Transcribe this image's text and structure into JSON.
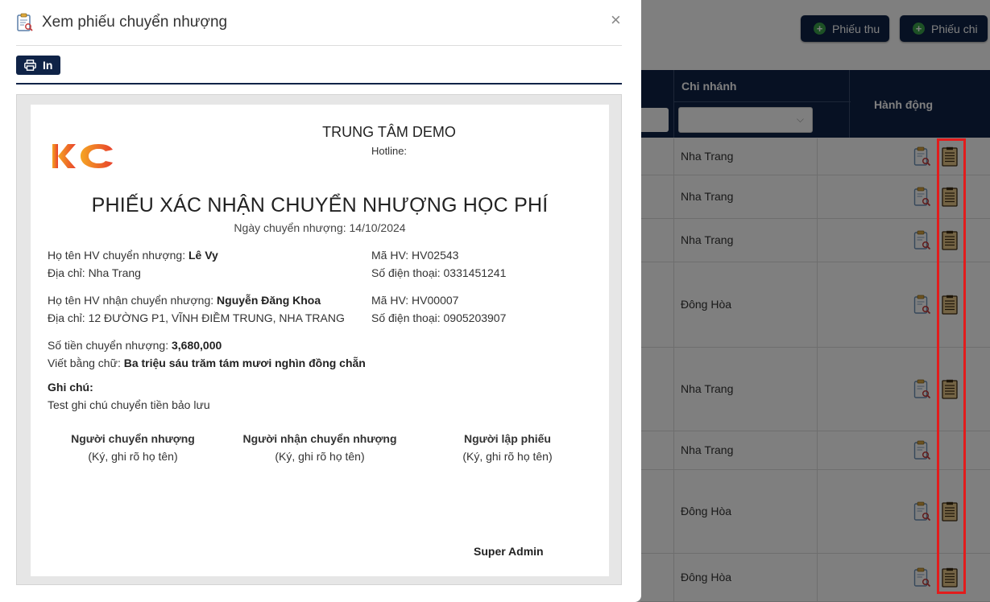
{
  "toolbar": {
    "receipt_label": "Phiếu thu",
    "payment_label": "Phiếu chi"
  },
  "table": {
    "branch_header": "Chi nhánh",
    "action_header": "Hành động",
    "rows": [
      {
        "branch": "Nha Trang"
      },
      {
        "branch": "Nha Trang"
      },
      {
        "branch": "Nha Trang"
      },
      {
        "branch": "Đông Hòa"
      },
      {
        "branch": "Nha Trang"
      },
      {
        "branch": "Nha Trang"
      },
      {
        "branch": "Đông Hòa"
      },
      {
        "branch": "Đông Hòa"
      }
    ]
  },
  "modal": {
    "title": "Xem phiếu chuyển nhượng",
    "print_label": "In",
    "close_glyph": "×"
  },
  "doc": {
    "logo_text": "KC",
    "center_name": "TRUNG TÂM DEMO",
    "hotline": "Hotline:",
    "heading": "PHIẾU XÁC NHẬN CHUYỂN NHƯỢNG HỌC PHÍ",
    "date_line": "Ngày chuyển nhượng: 14/10/2024",
    "from_name_label": "Họ tên HV chuyển nhượng: ",
    "from_name": "Lê Vy",
    "from_address": "Địa chỉ: Nha Trang",
    "from_code": "Mã HV: HV02543",
    "from_phone": "Số điện thoại: 0331451241",
    "to_name_label": "Họ tên HV nhận chuyển nhượng: ",
    "to_name": "Nguyễn Đăng Khoa",
    "to_address": "Địa chỉ: 12 ĐƯỜNG P1, VĨNH ĐIỀM TRUNG, NHA TRANG",
    "to_code": "Mã HV: HV00007",
    "to_phone": "Số điện thoại: 0905203907",
    "amount_label": "Số tiền chuyển nhượng: ",
    "amount": "3,680,000",
    "words_label": "Viết bằng chữ: ",
    "words": "Ba triệu sáu trăm tám mươi nghìn đồng chẵn",
    "note_label": "Ghi chú:",
    "note": "Test ghi chú chuyển tiền bảo lưu",
    "sig_from": "Người chuyển nhượng",
    "sig_to": "Người nhận chuyển nhượng",
    "sig_creator": "Người lập phiếu",
    "sig_hint": "(Ký, ghi rõ họ tên)",
    "creator_name": "Super Admin"
  },
  "colors": {
    "navy": "#0f2347",
    "logo_orange": "#f39a1e",
    "logo_red": "#e8412c",
    "highlight": "#e21c1c"
  },
  "icons": {
    "header": "receipt-search-icon",
    "print": "printer-icon",
    "close": "close-icon",
    "add": "plus-circle-icon",
    "view": "clipboard-search-icon",
    "doc": "document-list-icon"
  }
}
